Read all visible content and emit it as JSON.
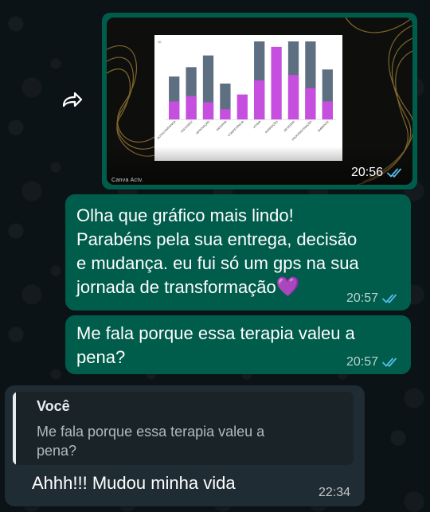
{
  "messages": {
    "image_msg": {
      "time": "20:56",
      "caption_watermark": "Canva Actv."
    },
    "msg1": {
      "lines": [
        "Olha que gráfico mais lindo!",
        "Parabéns pela sua entrega, decisão",
        "e mudança. eu fui só um gps na sua",
        "jornada de transformação"
      ],
      "emoji": "💜",
      "time": "20:57"
    },
    "msg2": {
      "lines": [
        "Me fala porque essa terapia valeu a",
        "pena?"
      ],
      "time": "20:57"
    },
    "reply": {
      "quote_author": "Você",
      "quote_lines": [
        "Me fala porque essa terapia valeu a",
        "pena?"
      ],
      "text": "Ahhh!!! Mudou minha vida",
      "time": "22:34"
    }
  },
  "colors": {
    "outgoing_bubble": "#005c4b",
    "incoming_bubble": "#202c33",
    "read_tick": "#53bdeb",
    "bar_before": "#5f6f82",
    "bar_after": "#c64fe0"
  },
  "icons": {
    "forward": "forward-arrow-icon",
    "read": "double-check-icon"
  },
  "chart_data": {
    "type": "bar",
    "ylim": [
      0,
      10
    ],
    "yticks": [
      "10"
    ],
    "categories": [
      "AUTOCONFIANÇA",
      "ESCASSEZ",
      "APROVAÇÃO",
      "PATERNA",
      "COMPETÊNCIA",
      "VITIMA",
      "PERFEIÇÃO",
      "DEVEDOR",
      "PROCRASTINAÇÃO",
      "AMBIENTE"
    ],
    "series": [
      {
        "values": [
          5.5,
          6.7,
          8.2,
          4.6,
          0,
          10,
          0,
          10,
          10,
          6.4
        ]
      },
      {
        "values": [
          2.3,
          3.0,
          2.2,
          1.3,
          3.2,
          5.0,
          9.3,
          5.7,
          4.0,
          2.3
        ]
      }
    ]
  }
}
